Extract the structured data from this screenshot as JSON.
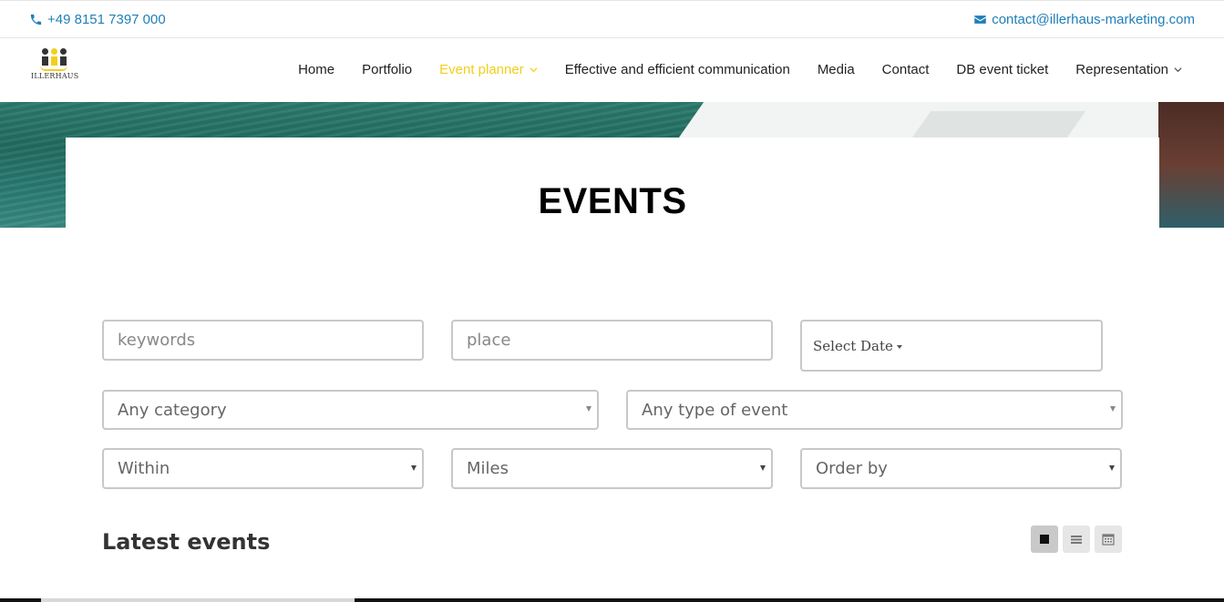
{
  "topbar": {
    "phone": "+49 8151 7397 000",
    "email": "contact@illerhaus-marketing.com",
    "phone_icon": "phone-icon",
    "email_icon": "envelope-icon"
  },
  "logo": {
    "name": "ILLERHAUS",
    "accent": "#f2cf1a"
  },
  "nav": {
    "items": [
      {
        "label": "Home"
      },
      {
        "label": "Portfolio"
      },
      {
        "label": "Event planner"
      },
      {
        "label": "Effective and efficient communication"
      },
      {
        "label": "Media"
      },
      {
        "label": "Contact"
      },
      {
        "label": "DB event ticket"
      },
      {
        "label": "Representation"
      }
    ],
    "active_color": "#f2cf1a"
  },
  "page": {
    "title": "EVENTS"
  },
  "filters": {
    "keywords_placeholder": "keywords",
    "place_placeholder": "place",
    "date_label": "Select Date",
    "category": "Any category",
    "event_type": "Any type of event",
    "within": "Within",
    "units": "Miles",
    "order_by": "Order by"
  },
  "events": {
    "heading": "Latest events",
    "view_icons": [
      "grid-view-icon",
      "list-view-icon",
      "calendar-view-icon"
    ]
  },
  "colors": {
    "link": "#1f7fb8",
    "accent": "#f2cf1a"
  }
}
